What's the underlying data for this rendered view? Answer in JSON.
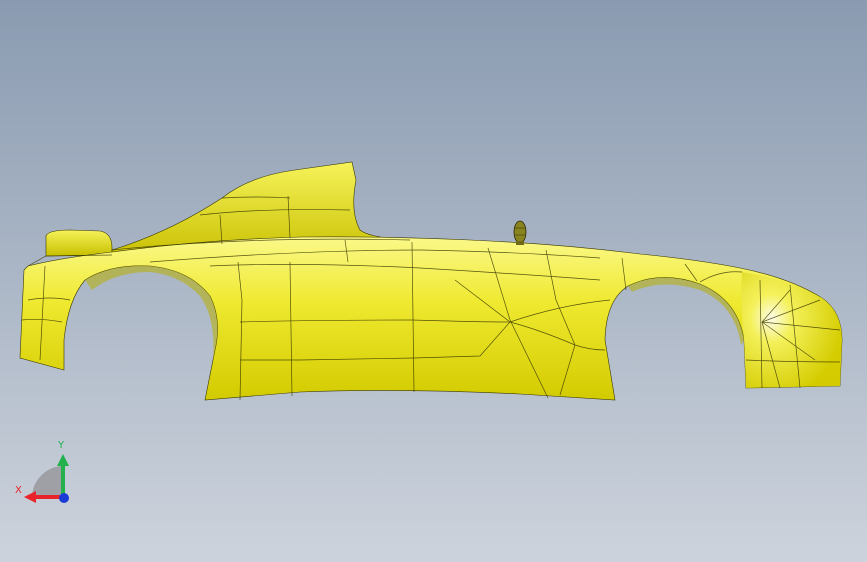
{
  "viewport": {
    "background_top": "#8a9bb1",
    "background_bottom": "#cdd3dc"
  },
  "model": {
    "fill_light": "#f4f27a",
    "fill_mid": "#e9e41c",
    "fill_dark": "#c9c200",
    "edge_color": "#3a3800"
  },
  "triad": {
    "x_label": "X",
    "y_label": "Y",
    "x_color": "#e8232a",
    "y_color": "#22b14c",
    "z_color": "#1a3ad6"
  }
}
